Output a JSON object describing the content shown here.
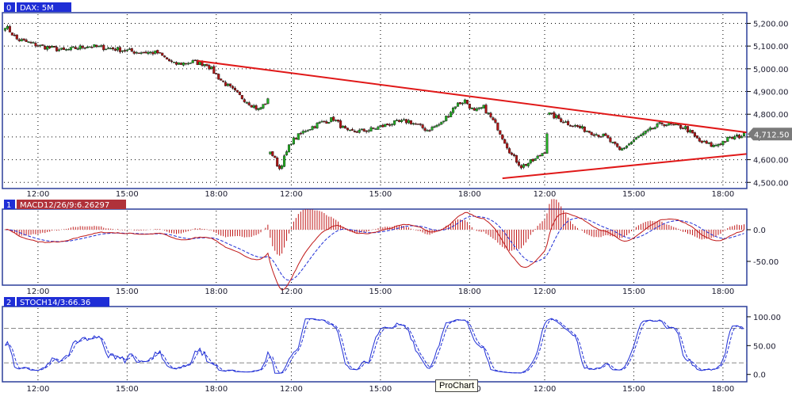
{
  "colors": {
    "frame": "#2b3f9a",
    "tag_blue": "#1f2ed6",
    "tag_red": "#b0323a",
    "up_candle": "#22b022",
    "down_candle": "#b01515",
    "trendline": "#e01818",
    "macd_line": "#c01818",
    "signal_line": "#1f2ed6",
    "stoch_k": "#1f2ed6",
    "grid": "#000000",
    "price_tag_bg": "#7a7a7a"
  },
  "chart_data": [
    {
      "type": "candlestick",
      "panel_index": "0",
      "title": "DAX: 5M",
      "x_tick_labels": [
        "12:00",
        "15:00",
        "18:00",
        "12:00",
        "15:00",
        "18:00",
        "12:00",
        "15:00",
        "18:00"
      ],
      "y_tick_labels": [
        "5,200.00",
        "5,100.00",
        "5,000.00",
        "4,900.00",
        "4,800.00",
        "4,700.00",
        "4,600.00",
        "4,500.00"
      ],
      "ylim": [
        4480,
        5240
      ],
      "last_price_label": "4,712.50",
      "last_price": 4712.5,
      "bars": 316,
      "price_keyframes": [
        [
          0,
          5190
        ],
        [
          5,
          5130
        ],
        [
          15,
          5100
        ],
        [
          25,
          5080
        ],
        [
          35,
          5100
        ],
        [
          45,
          5090
        ],
        [
          55,
          5075
        ],
        [
          65,
          5070
        ],
        [
          72,
          5020
        ],
        [
          80,
          5030
        ],
        [
          86,
          5020
        ],
        [
          92,
          4950
        ],
        [
          100,
          4880
        ],
        [
          108,
          4820
        ],
        [
          112,
          4860
        ],
        [
          113,
          4640
        ],
        [
          117,
          4560
        ],
        [
          122,
          4680
        ],
        [
          128,
          4730
        ],
        [
          134,
          4760
        ],
        [
          140,
          4780
        ],
        [
          146,
          4720
        ],
        [
          155,
          4730
        ],
        [
          165,
          4760
        ],
        [
          172,
          4770
        ],
        [
          180,
          4730
        ],
        [
          186,
          4760
        ],
        [
          192,
          4840
        ],
        [
          196,
          4860
        ],
        [
          200,
          4810
        ],
        [
          204,
          4830
        ],
        [
          210,
          4740
        ],
        [
          216,
          4620
        ],
        [
          220,
          4570
        ],
        [
          226,
          4600
        ],
        [
          230,
          4640
        ],
        [
          232,
          4800
        ],
        [
          240,
          4760
        ],
        [
          250,
          4720
        ],
        [
          256,
          4700
        ],
        [
          262,
          4640
        ],
        [
          270,
          4700
        ],
        [
          280,
          4760
        ],
        [
          290,
          4740
        ],
        [
          296,
          4680
        ],
        [
          302,
          4660
        ],
        [
          308,
          4690
        ],
        [
          316,
          4712
        ]
      ],
      "trendlines": [
        {
          "from": [
            82,
            5035
          ],
          "to": [
            316,
            4720
          ]
        },
        {
          "from": [
            212,
            4518
          ],
          "to": [
            316,
            4625
          ]
        }
      ]
    },
    {
      "type": "line",
      "panel_index": "1",
      "title": "MACD12/26/9:6.26297",
      "x_tick_labels": [
        "12:00",
        "15:00",
        "18:00",
        "12:00",
        "15:00",
        "18:00",
        "12:00",
        "15:00",
        "18:00"
      ],
      "y_tick_labels": [
        "0.0",
        "-50.00"
      ],
      "ylim": [
        -85,
        30
      ],
      "series": [
        "macd",
        "signal",
        "histogram"
      ]
    },
    {
      "type": "line",
      "panel_index": "2",
      "title": "STOCH14/3:66.36",
      "x_tick_labels": [
        "12:00",
        "15:00",
        "18:00",
        "12:00",
        "15:00",
        "18:00",
        "12:00",
        "15:00",
        "18:00"
      ],
      "y_tick_labels": [
        "100.00",
        "50.00",
        "0.0"
      ],
      "ylim": [
        -10,
        115
      ],
      "reference_levels": [
        80,
        20
      ],
      "series": [
        "%K",
        "%D"
      ]
    }
  ],
  "tooltip": "ProChart"
}
